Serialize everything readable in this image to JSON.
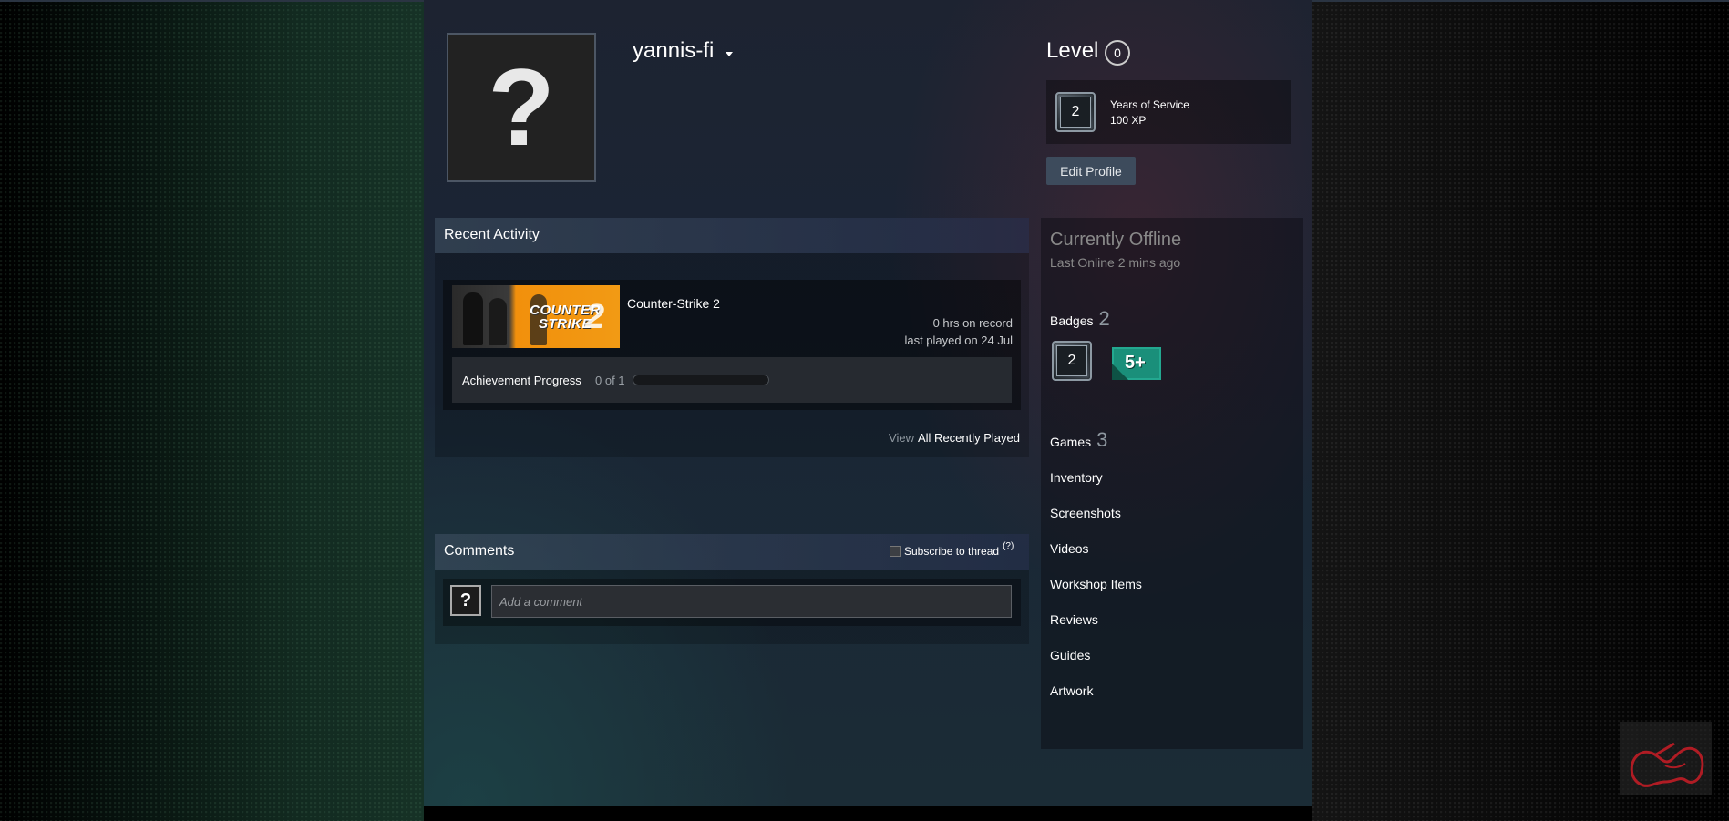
{
  "profile": {
    "persona_name": "yannis-fi",
    "avatar_placeholder": "?"
  },
  "level": {
    "label": "Level",
    "value": "0"
  },
  "favorite_badge": {
    "value": "2",
    "title": "Years of Service",
    "xp": "100 XP"
  },
  "edit_profile_label": "Edit Profile",
  "recent_activity": {
    "header": "Recent Activity",
    "game": {
      "name": "Counter-Strike 2",
      "logo_line1": "COUNTER",
      "logo_line2": "STRIKE",
      "logo_number": "2",
      "hours": "0 hrs on record",
      "last_played": "last played on 24 Jul",
      "achievement_label": "Achievement Progress",
      "achievement_count": "0 of 1",
      "achievement_fraction": 0
    },
    "view_label": "View",
    "view_all_label": "All Recently Played"
  },
  "comments": {
    "header": "Comments",
    "subscribe_label": "Subscribe to thread",
    "help_label": "(?)",
    "placeholder": "Add a comment",
    "avatar_placeholder": "?"
  },
  "status": {
    "state": "Currently Offline",
    "last_online": "Last Online 2 mins ago"
  },
  "badges": {
    "label": "Badges",
    "count": "2",
    "items": [
      "2",
      "5+"
    ]
  },
  "games": {
    "label": "Games",
    "count": "3"
  },
  "links": [
    "Inventory",
    "Screenshots",
    "Videos",
    "Workshop Items",
    "Reviews",
    "Guides",
    "Artwork"
  ],
  "colors": {
    "accent_blue": "#5aa9e6",
    "badge_teal": "#1a8f7a",
    "offline_gray": "#898989"
  }
}
